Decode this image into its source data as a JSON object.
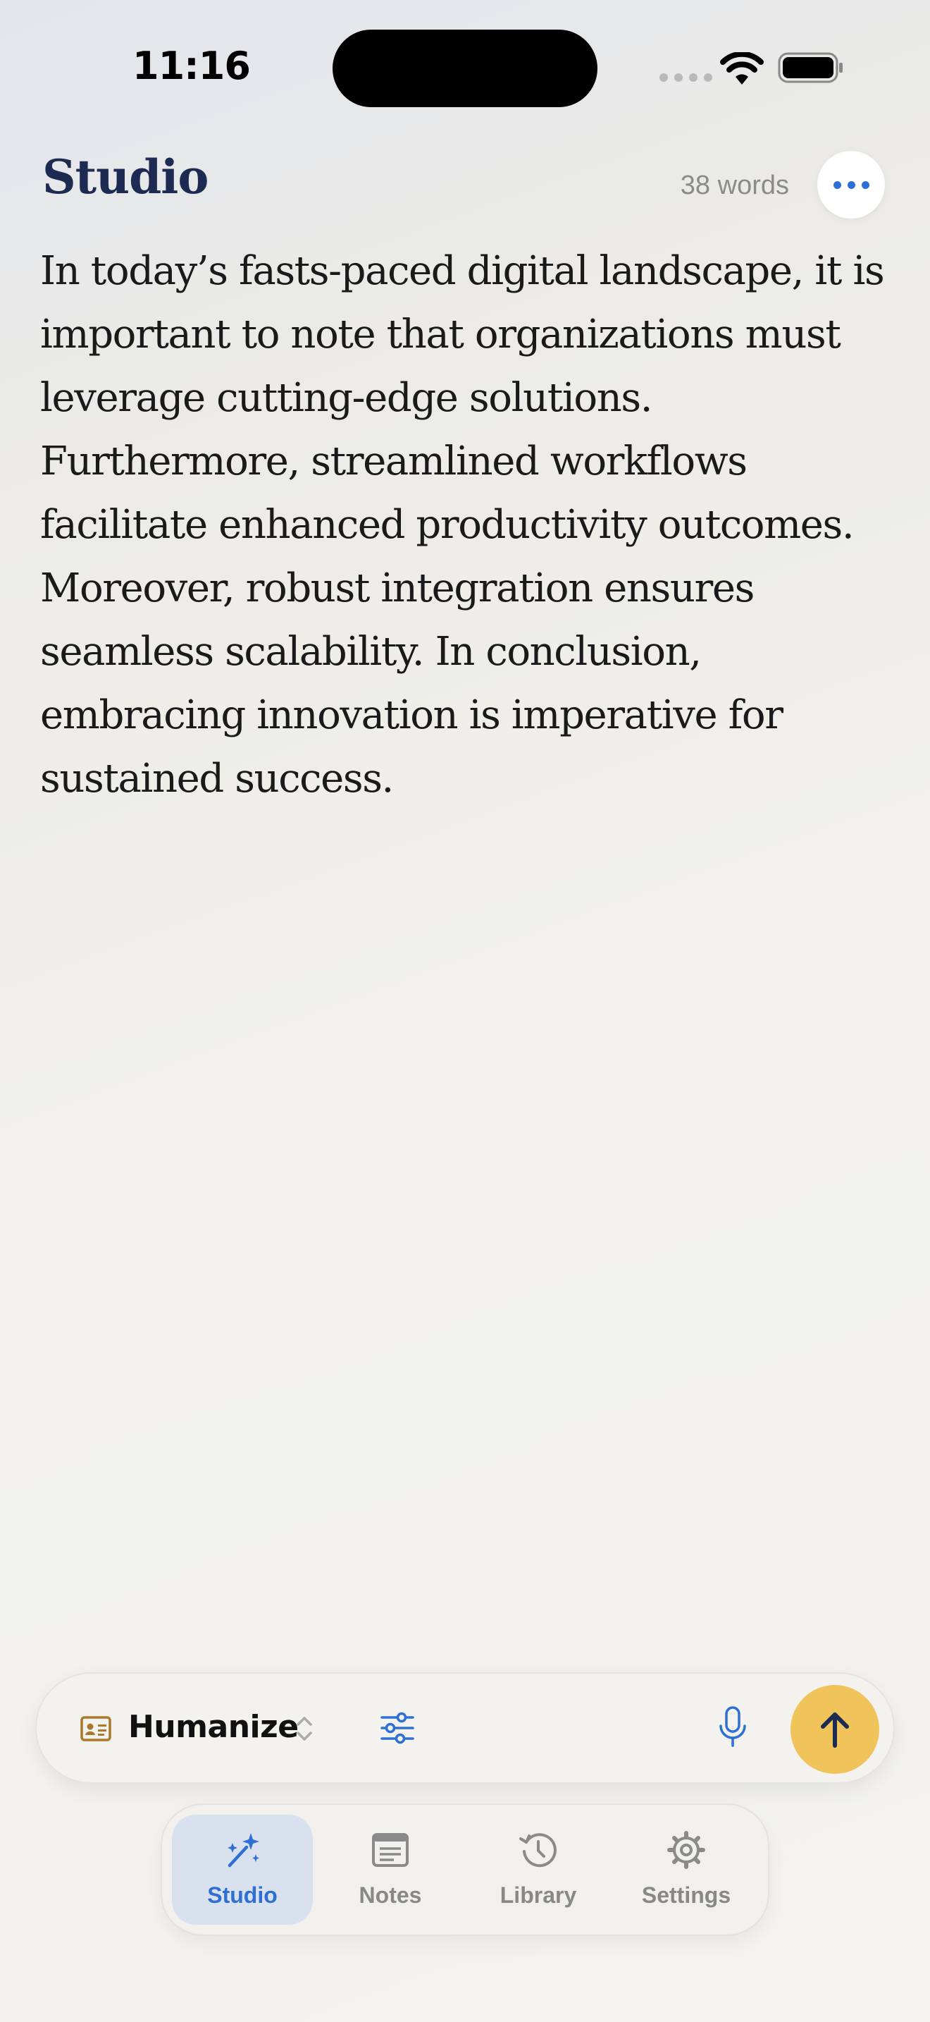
{
  "status_bar": {
    "time": "11:16"
  },
  "header": {
    "title": "Studio",
    "word_count": "38 words"
  },
  "document": {
    "text": "In today’s fasts-paced digital landscape, it is important to note that organizations must leverage cutting-edge solutions. Furthermore, streamlined workflows facilitate enhanced productivity outcomes. Moreover, robust integration ensures seamless scalability. In conclusion, embracing innovation is imperative for sustained success."
  },
  "composer": {
    "mode_label": "Humanize",
    "mode_icon": "id-card-icon",
    "send_icon": "arrow-up-icon"
  },
  "tabs": [
    {
      "label": "Studio",
      "icon": "magic-wand-icon",
      "active": true
    },
    {
      "label": "Notes",
      "icon": "note-icon",
      "active": false
    },
    {
      "label": "Library",
      "icon": "history-icon",
      "active": false
    },
    {
      "label": "Settings",
      "icon": "gear-icon",
      "active": false
    }
  ],
  "colors": {
    "accent": "#2e6fd4",
    "title": "#1d2b52",
    "send": "#f0c35b",
    "mode_icon": "#a97a2c"
  }
}
